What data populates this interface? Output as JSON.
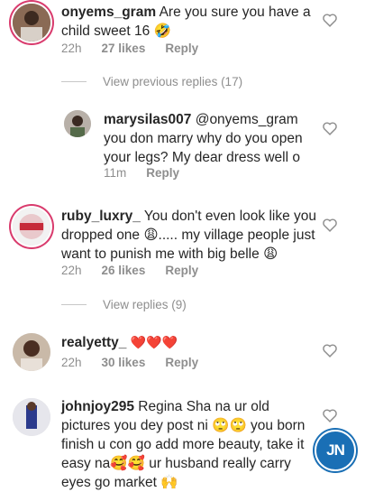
{
  "comments": [
    {
      "username": "onyems_gram",
      "text": "Are you sure you have a child sweet 16 🤣",
      "time": "22h",
      "likes": "27 likes",
      "reply": "Reply"
    },
    {
      "username": "marysilas007",
      "text": "@onyems_gram you don marry why do you open your legs? My dear dress well o",
      "time": "11m",
      "likes": "",
      "reply": "Reply"
    },
    {
      "username": "ruby_luxry_",
      "text": "You don't even look like you dropped one 😩..... my village people just want to punish me with big belle 😩",
      "time": "22h",
      "likes": "26 likes",
      "reply": "Reply"
    },
    {
      "username": "realyetty_",
      "text": "❤️❤️❤️",
      "time": "22h",
      "likes": "30 likes",
      "reply": "Reply"
    },
    {
      "username": "johnjoy295",
      "text": "Regina Sha na ur old pictures you dey post ni 🙄🙄 you born finish u con go add more beauty, take it easy na🥰🥰 ur husband really carry eyes go market 🙌",
      "time": "",
      "likes": "",
      "reply": ""
    }
  ],
  "view_previous_replies": "View previous replies (17)",
  "view_replies": "View replies (9)",
  "watermark": "JN",
  "icons": {
    "like": "heart-outline-icon"
  },
  "colors": {
    "story_ring": "#d93b6d",
    "meta_grey": "#8e8e8e",
    "badge": "#1a6fb5"
  }
}
